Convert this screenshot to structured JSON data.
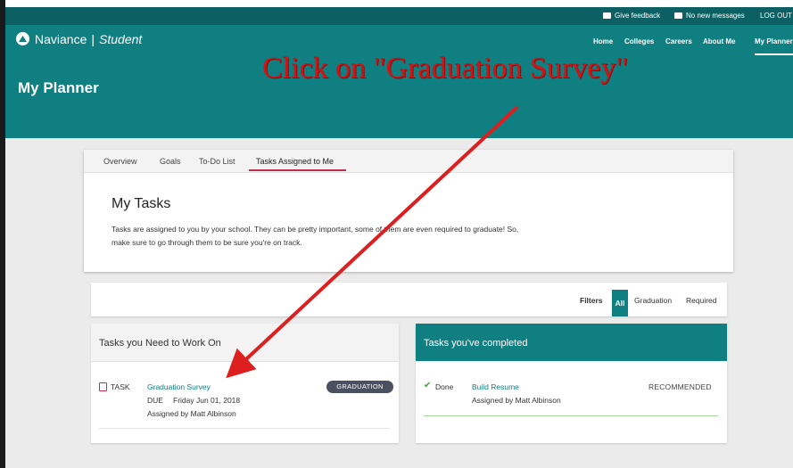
{
  "topbar": {
    "feedback_label": "Give feedback",
    "messages_label": "No new messages",
    "logout_label": "LOG OUT"
  },
  "header": {
    "brand": "Naviance",
    "brand_separator": "|",
    "brand_sub": "Student",
    "page_title": "My Planner",
    "nav": {
      "home": "Home",
      "colleges": "Colleges",
      "careers": "Careers",
      "about_me": "About Me",
      "my_planner": "My Planner"
    }
  },
  "annotation": {
    "text": "Click on \"Graduation Survey\"",
    "color": "#cc1515"
  },
  "tabs": {
    "overview": "Overview",
    "goals": "Goals",
    "todo": "To-Do List",
    "assigned": "Tasks Assigned to Me"
  },
  "my_tasks": {
    "title": "My Tasks",
    "description": "Tasks are assigned to you by your school. They can be pretty important, some of them are even required to graduate! So, make sure to go through them to be sure you're on track."
  },
  "filters": {
    "label": "Filters",
    "all": "All",
    "graduation": "Graduation",
    "required": "Required"
  },
  "work_on": {
    "title": "Tasks you Need to Work On",
    "task_label": "TASK",
    "task_name": "Graduation Survey",
    "due_label": "DUE",
    "due_date": "Friday Jun 01, 2018",
    "assigned_by": "Assigned by Matt Albinson",
    "badge": "GRADUATION"
  },
  "completed": {
    "title": "Tasks you've completed",
    "status": "Done",
    "task_name": "Build Resume",
    "assigned_by": "Assigned by Matt Albinson",
    "tag": "RECOMMENDED"
  },
  "colors": {
    "brand_teal": "#0f7f81",
    "topbar": "#0c5f62",
    "tab_accent": "#c0304e",
    "badge": "#4a5060",
    "done_check": "#3aa83a"
  },
  "icons": {
    "logo": "naviance-logo-icon",
    "feedback": "chat-bubble-icon",
    "messages": "envelope-icon",
    "task": "clipboard-icon",
    "done": "checkmark-icon"
  }
}
